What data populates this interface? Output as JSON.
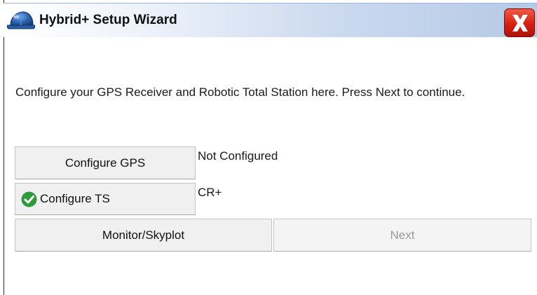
{
  "window": {
    "title": "Hybrid+ Setup Wizard",
    "icon": "hard-hat-icon",
    "close_icon": "close-x-icon"
  },
  "main": {
    "instruction": "Configure your GPS Receiver and Robotic Total Station here. Press Next to continue."
  },
  "gps": {
    "button_label": "Configure GPS",
    "status": "Not Configured"
  },
  "ts": {
    "button_label": "Configure TS",
    "button_icon": "check-circle-icon",
    "status": "CR+"
  },
  "footer": {
    "monitor_label": "Monitor/Skyplot",
    "next_label": "Next",
    "next_enabled": false
  },
  "colors": {
    "close_red": "#d8200f",
    "check_green": "#2e9b3a",
    "helmet_blue": "#2f66b3",
    "disabled_text": "#9a9a9a"
  }
}
